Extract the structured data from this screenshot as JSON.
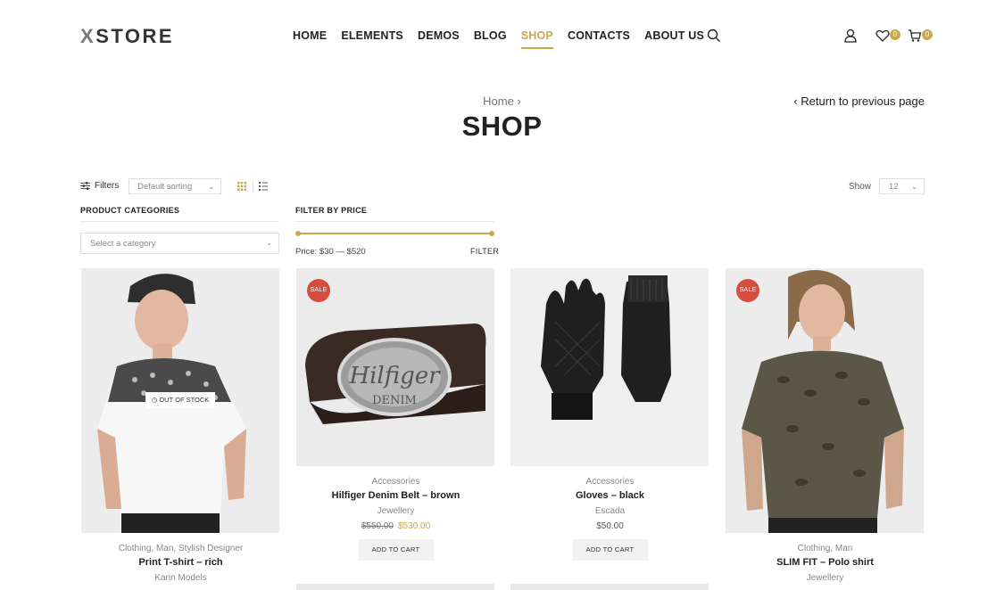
{
  "header": {
    "logo_x": "X",
    "logo_rest": "STORE",
    "nav": [
      {
        "label": "HOME"
      },
      {
        "label": "ELEMENTS"
      },
      {
        "label": "DEMOS"
      },
      {
        "label": "BLOG"
      },
      {
        "label": "SHOP",
        "active": true
      },
      {
        "label": "CONTACTS"
      },
      {
        "label": "ABOUT US"
      }
    ],
    "wishlist_count": "0",
    "cart_count": "0"
  },
  "page": {
    "breadcrumb": "Home",
    "breadcrumb_sep": "›",
    "title": "SHOP",
    "return_link": "Return to previous page",
    "return_arrow": "‹"
  },
  "toolbar": {
    "filters_label": "Filters",
    "sorting": "Default sorting",
    "show_label": "Show",
    "show_value": "12"
  },
  "widgets": {
    "categories_title": "PRODUCT CATEGORIES",
    "category_placeholder": "Select a category",
    "price_title": "FILTER BY PRICE",
    "price_range": "Price: $30 — $520",
    "filter_button": "FILTER"
  },
  "products": [
    {
      "category": "Clothing, Man, Stylish Designer",
      "name": "Print T-shirt – rich",
      "brand": "Karin Models",
      "out_of_stock": "OUT OF STOCK"
    },
    {
      "category": "Accessories",
      "name": "Hilfiger Denim Belt – brown",
      "brand": "Jewellery",
      "old_price": "$550.00",
      "new_price": "$530.00",
      "sale": "SALE",
      "add_to_cart": "ADD TO CART"
    },
    {
      "category": "Accessories",
      "name": "Gloves – black",
      "brand": "Escada",
      "price": "$50.00",
      "add_to_cart": "ADD TO CART"
    },
    {
      "category": "Clothing, Man",
      "name": "SLIM FIT – Polo shirt",
      "brand": "Jewellery",
      "sale": "SALE"
    }
  ],
  "colors": {
    "accent": "#c8a94f",
    "sale": "#d64d3f"
  }
}
